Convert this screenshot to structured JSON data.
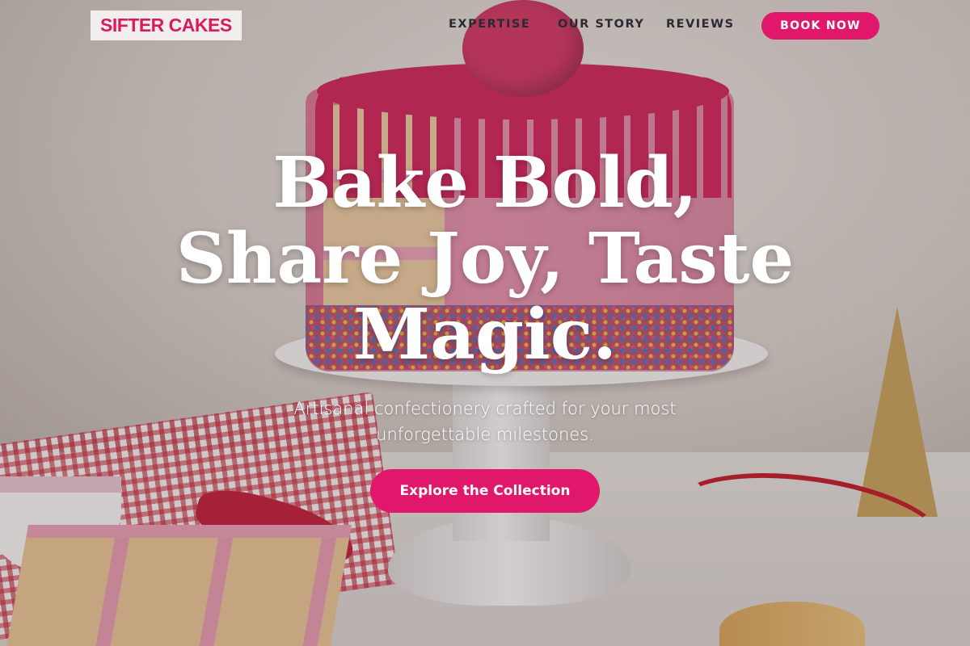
{
  "brand": {
    "logo_text": "SIFTER CAKES",
    "accent_color": "#e0176a"
  },
  "nav": {
    "links": [
      {
        "label": "EXPERTISE"
      },
      {
        "label": "OUR STORY"
      },
      {
        "label": "REVIEWS"
      }
    ],
    "cta_label": "BOOK NOW"
  },
  "hero": {
    "headline": "Bake Bold, Share Joy, Taste Magic.",
    "subtitle": "Artisanal confectionery crafted for your most unforgettable milestones.",
    "cta_label": "Explore the Collection",
    "background_image": "pink drip cake with sprinkles on a white cake stand"
  }
}
